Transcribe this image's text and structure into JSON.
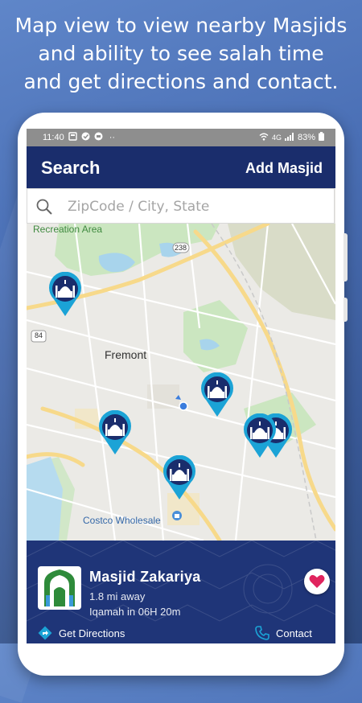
{
  "headline": {
    "line1": "Map view to view nearby Masjids",
    "line2": "and ability to see salah time",
    "line3": "and get directions and contact."
  },
  "status_bar": {
    "time": "11:40",
    "battery": "83%",
    "network": "4G",
    "dots": "··"
  },
  "app_bar": {
    "title": "Search",
    "add_label": "Add Masjid"
  },
  "search": {
    "placeholder": "ZipCode / City, State"
  },
  "map": {
    "labels": {
      "recreation_area": "Recreation Area",
      "city": "Fremont",
      "store": "Costco Wholesale",
      "route_84": "84",
      "route_238": "238"
    },
    "pin_count": 6
  },
  "card": {
    "name": "Masjid Zakariya",
    "distance": "1.8 mi away",
    "iqamah_label": "Iqamah in",
    "iqamah_time": "06H 20m",
    "directions_label": "Get Directions",
    "contact_label": "Contact",
    "favorited": true
  },
  "colors": {
    "app_bar": "#1a2d6c",
    "card": "#1f3578",
    "pin": "#1ba3d6",
    "pin_inner": "#1a2d6c",
    "heart": "#e0245e",
    "green_area": "#cbe6c0",
    "water": "#a8d4ec",
    "major_road": "#f7d98a"
  }
}
